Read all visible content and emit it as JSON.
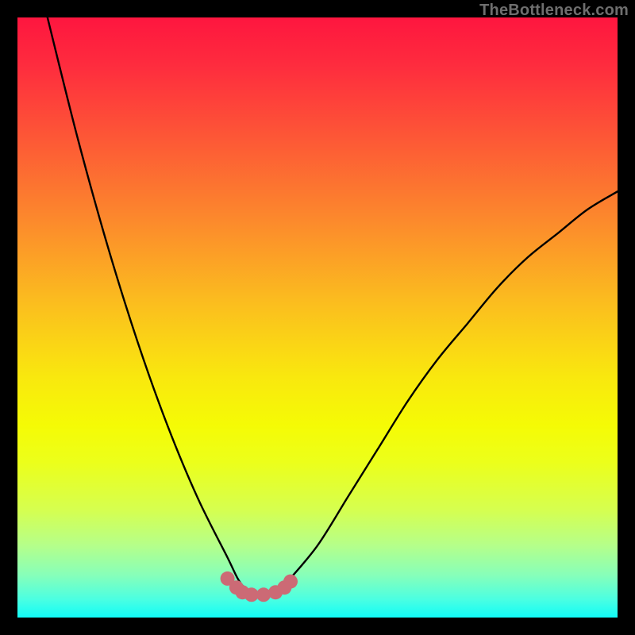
{
  "watermark": "TheBottleneck.com",
  "chart_data": {
    "type": "line",
    "title": "",
    "xlabel": "",
    "ylabel": "",
    "xlim": [
      0,
      100
    ],
    "ylim": [
      0,
      100
    ],
    "series": [
      {
        "name": "bottleneck-curve",
        "x": [
          5,
          10,
          15,
          20,
          25,
          30,
          35,
          37,
          39,
          41,
          43,
          45,
          50,
          55,
          60,
          65,
          70,
          75,
          80,
          85,
          90,
          95,
          100
        ],
        "y": [
          100,
          80,
          62,
          46,
          32,
          20,
          10,
          6,
          4,
          4,
          4,
          6,
          12,
          20,
          28,
          36,
          43,
          49,
          55,
          60,
          64,
          68,
          71
        ]
      }
    ],
    "markers": {
      "name": "highlight-dots",
      "x": [
        35.0,
        36.5,
        37.5,
        39.0,
        41.0,
        43.0,
        44.5,
        45.5
      ],
      "y": [
        6.5,
        5.0,
        4.2,
        3.8,
        3.8,
        4.2,
        5.0,
        6.0
      ]
    },
    "colors": {
      "curve": "#000000",
      "markers": "#cc6a75",
      "gradient_top": "#fe163f",
      "gradient_bottom": "#11fcf7"
    }
  }
}
